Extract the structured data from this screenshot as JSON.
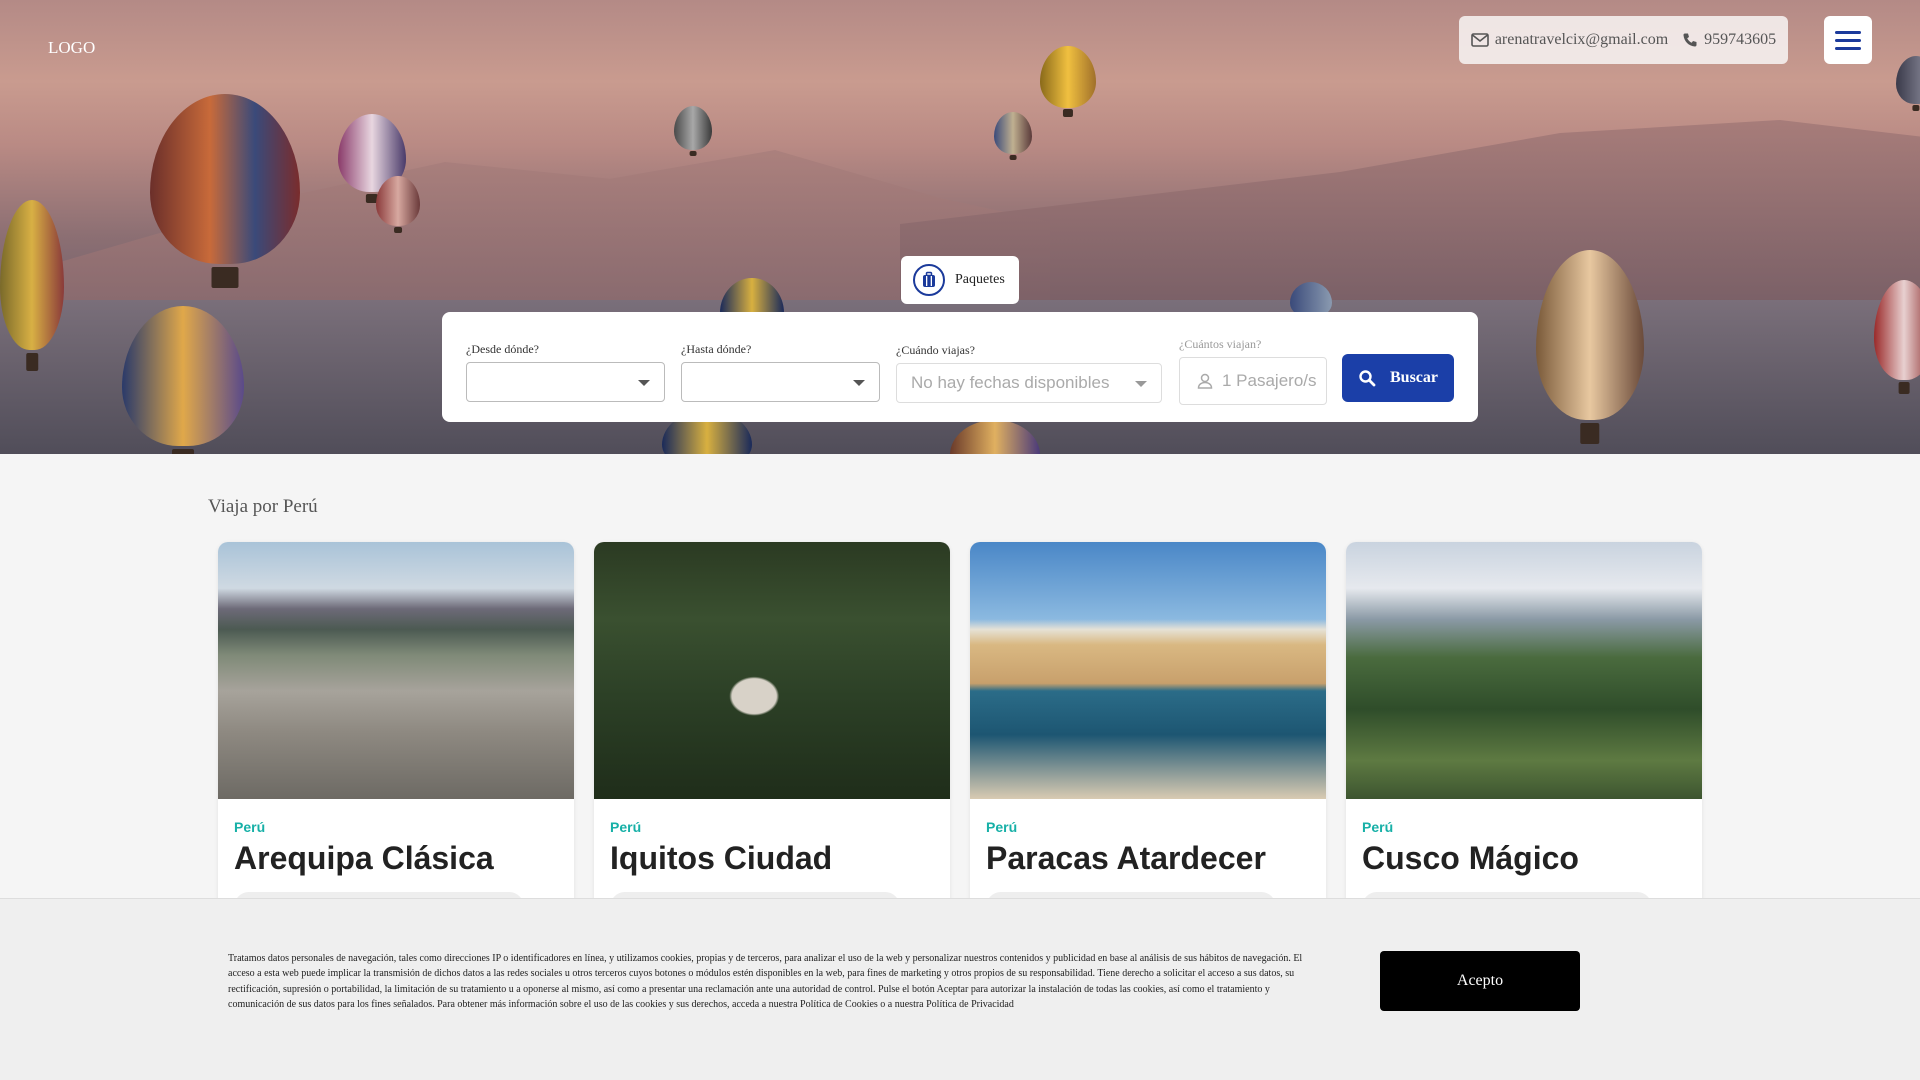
{
  "header": {
    "logo_alt": "LOGO",
    "email": "arenatravelcix@gmail.com",
    "phone": "959743605"
  },
  "search": {
    "tab_label": "Paquetes",
    "from_label": "¿Desde dónde?",
    "to_label": "¿Hasta dónde?",
    "when_label": "¿Cuándo viajas?",
    "when_placeholder": "No hay fechas disponibles",
    "pax_label": "¿Cuántos viajan?",
    "pax_value": "1 Pasajero/s",
    "button_label": "Buscar"
  },
  "section": {
    "title": "Viaja por Perú",
    "cards": [
      {
        "country": "Perú",
        "title": "Arequipa Clásica"
      },
      {
        "country": "Perú",
        "title": "Iquitos Ciudad"
      },
      {
        "country": "Perú",
        "title": "Paracas Atardecer"
      },
      {
        "country": "Perú",
        "title": "Cusco Mágico"
      }
    ]
  },
  "cookie": {
    "text": "Tratamos datos personales de navegación, tales como direcciones IP o identificadores en línea, y utilizamos cookies, propias y de terceros, para analizar el uso de la web y personalizar nuestros contenidos y publicidad en base al análisis de sus hábitos de navegación. El acceso a esta web puede implicar la transmisión de dichos datos a las redes sociales u otros terceros cuyos botones o módulos estén disponibles en la web, para fines de marketing y otros propios de su responsabilidad. Tiene derecho a solicitar el acceso a sus datos, su rectificación, supresión o portabilidad, la limitación de su tratamiento u a oponerse al mismo, así como a presentar una reclamación ante una autoridad de control. Pulse el botón Aceptar para autorizar la instalación de todas las cookies, así como el tratamiento y comunicación de sus datos para los fines señalados. Para obtener más información sobre el uso de las cookies y sus derechos, acceda a nuestra Política de Cookies o a nuestra Política de Privacidad",
    "accept_label": "Acepto"
  },
  "colors": {
    "primary": "#1b3fa8",
    "accent_teal": "#17b0a7"
  }
}
